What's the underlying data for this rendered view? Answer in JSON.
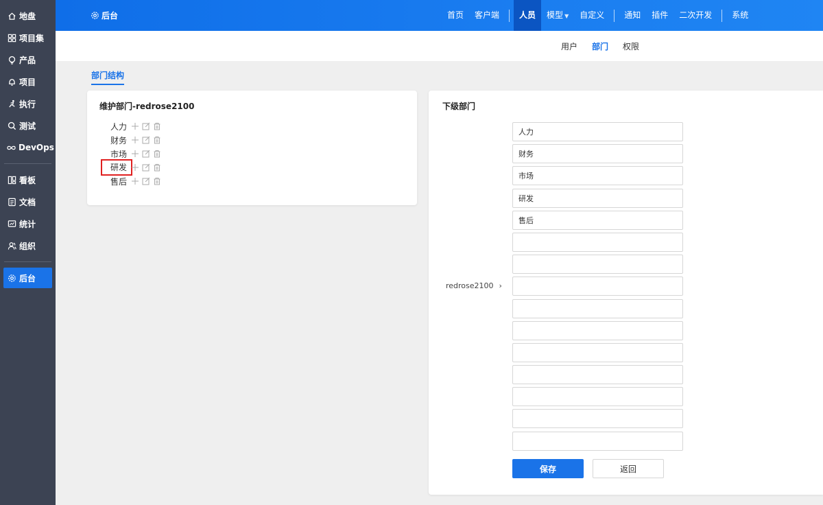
{
  "sidebar": {
    "items": [
      {
        "label": "地盘",
        "icon": "home-icon"
      },
      {
        "label": "项目集",
        "icon": "grid-icon"
      },
      {
        "label": "产品",
        "icon": "lightbulb-icon"
      },
      {
        "label": "项目",
        "icon": "bell-icon"
      },
      {
        "label": "执行",
        "icon": "run-icon"
      },
      {
        "label": "测试",
        "icon": "search-icon"
      },
      {
        "label": "DevOps",
        "icon": "infinity-icon"
      },
      {
        "label": "看板",
        "icon": "kanban-icon"
      },
      {
        "label": "文档",
        "icon": "doc-icon"
      },
      {
        "label": "统计",
        "icon": "chart-icon"
      },
      {
        "label": "组织",
        "icon": "users-icon"
      },
      {
        "label": "后台",
        "icon": "gear-icon"
      }
    ],
    "active": "后台"
  },
  "topbar": {
    "brand": "后台",
    "nav": [
      "首页",
      "客户端",
      "人员",
      "模型",
      "自定义",
      "通知",
      "插件",
      "二次开发",
      "系统"
    ],
    "active": "人员"
  },
  "subnav": {
    "items": [
      "用户",
      "部门",
      "权限"
    ],
    "active": "部门"
  },
  "section_tab": "部门结构",
  "left_panel": {
    "title": "维护部门-redrose2100",
    "departments": [
      "人力",
      "财务",
      "市场",
      "研发",
      "售后"
    ],
    "highlighted": "研发"
  },
  "right_panel": {
    "title": "下级部门",
    "parent": "redrose2100",
    "parent_arrow": "›",
    "values": [
      "人力",
      "财务",
      "市场",
      "研发",
      "售后",
      "",
      "",
      "",
      "",
      "",
      "",
      "",
      "",
      "",
      ""
    ],
    "save_label": "保存",
    "back_label": "返回"
  },
  "colors": {
    "accent": "#1a73e8",
    "sidebar_bg": "#3c4353",
    "highlight_border": "#e02020"
  }
}
